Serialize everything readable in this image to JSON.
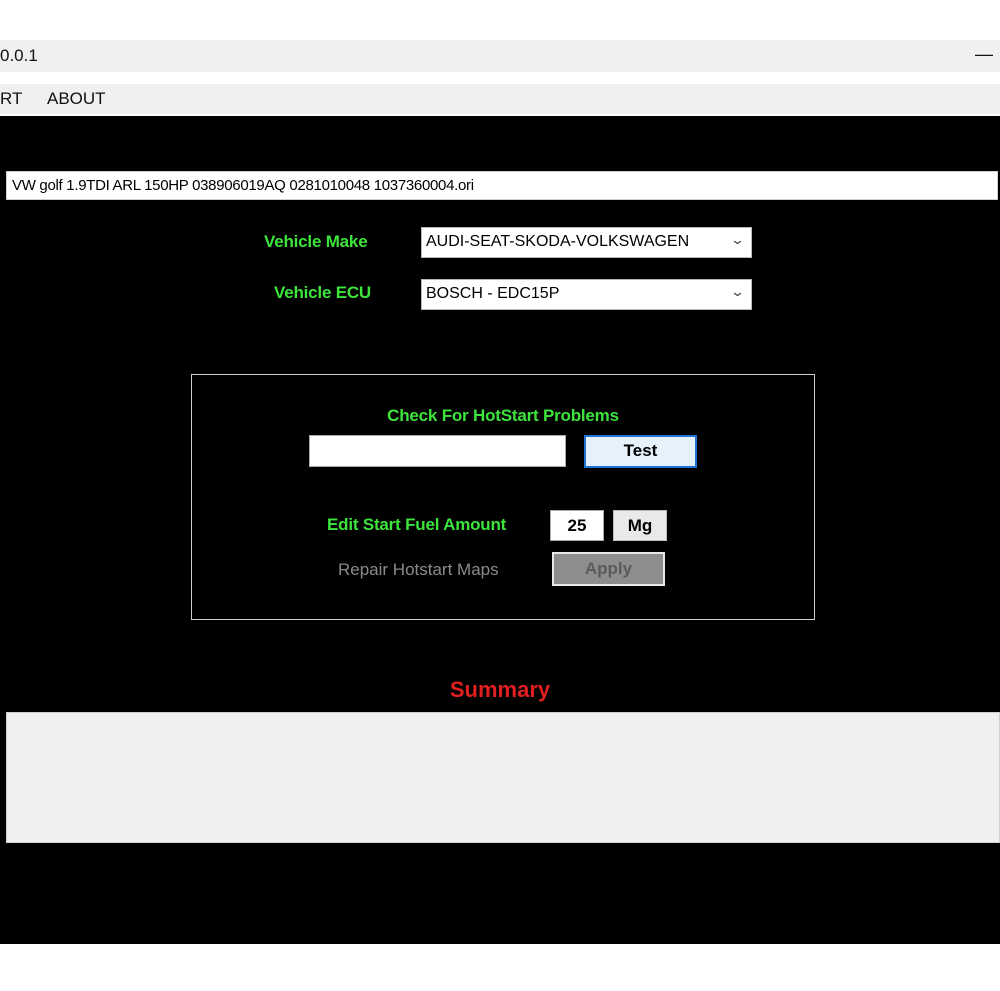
{
  "window": {
    "title": "0.0.1",
    "minimize_glyph": "—"
  },
  "menu": {
    "items": [
      "RT",
      "ABOUT"
    ]
  },
  "file": {
    "name": "VW golf 1.9TDI ARL 150HP 038906019AQ 0281010048 1037360004.ori"
  },
  "vehicle": {
    "make_label": "Vehicle Make",
    "make_value": "AUDI-SEAT-SKODA-VOLKSWAGEN",
    "ecu_label": "Vehicle ECU",
    "ecu_value": "BOSCH - EDC15P"
  },
  "hotstart": {
    "check_label": "Check For HotStart Problems",
    "result_value": "",
    "test_label": "Test",
    "fuel_label": "Edit Start Fuel Amount",
    "fuel_value": "25",
    "unit_label": "Mg",
    "repair_label": "Repair Hotstart Maps",
    "apply_label": "Apply"
  },
  "summary": {
    "title": "Summary",
    "content": ""
  },
  "colors": {
    "background": "#000000",
    "label_green": "#3ce43c",
    "summary_red": "#e02020",
    "disabled_gray": "#8a8a8a"
  },
  "icons": {
    "dropdown": "chevron-down-icon",
    "minimize": "minimize-icon"
  }
}
